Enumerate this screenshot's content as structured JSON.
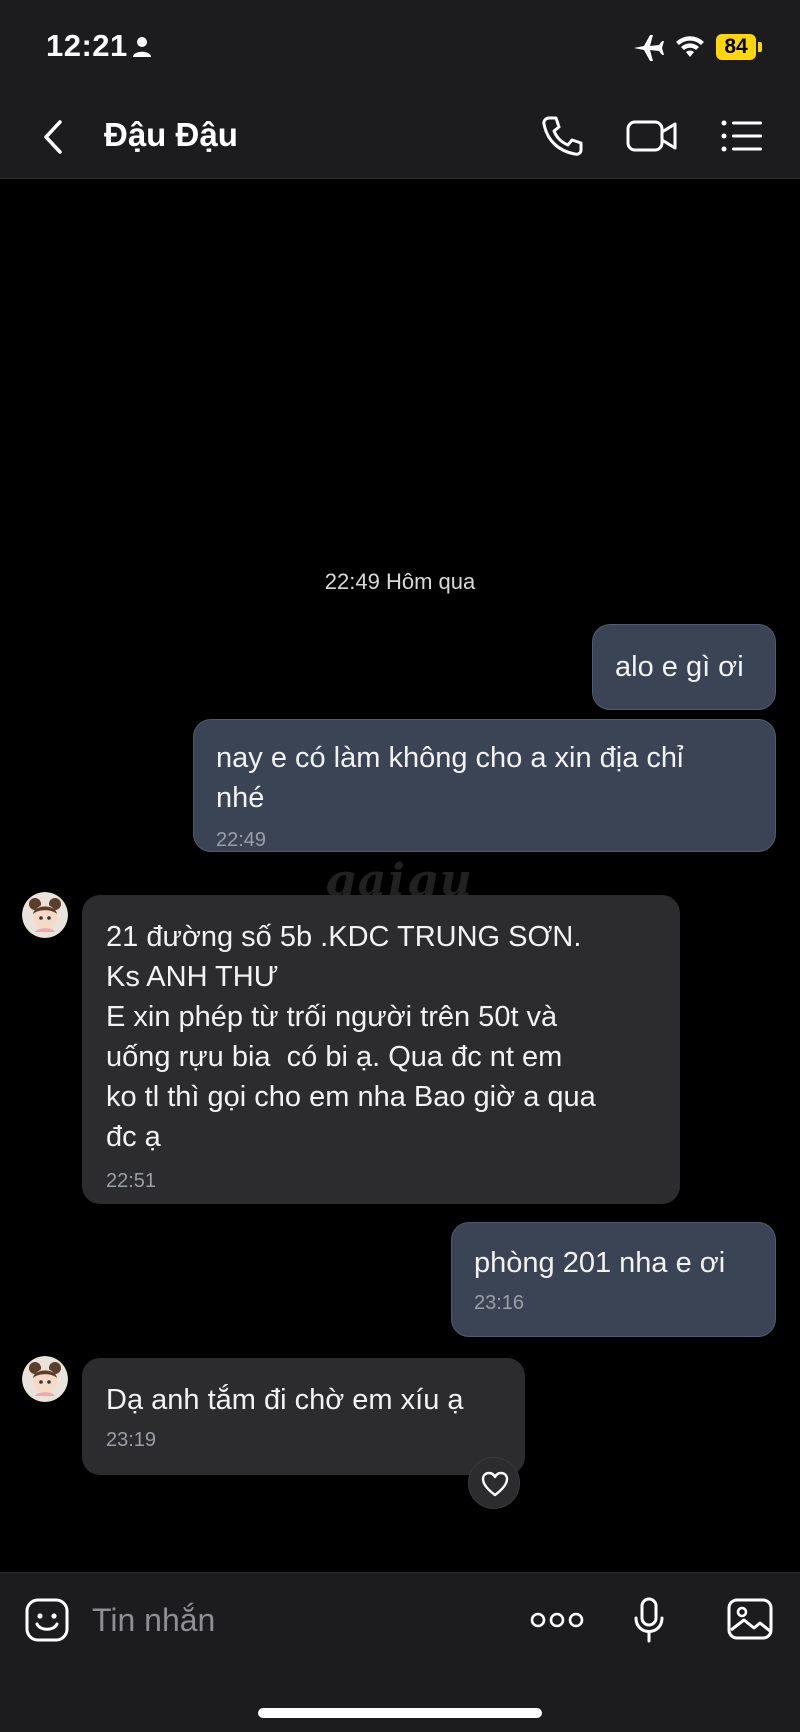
{
  "status_bar": {
    "time": "12:21",
    "battery": "84",
    "icons": [
      "person-icon",
      "airplane-icon",
      "wifi-icon",
      "battery-icon"
    ],
    "battery_color": "#ffd60a"
  },
  "header": {
    "back_icon": "chevron-left-icon",
    "title": "Đậu Đậu",
    "actions": [
      "phone-icon",
      "video-call-icon",
      "list-menu-icon"
    ]
  },
  "chat": {
    "day_separator": "22:49 Hôm qua",
    "watermark": "gaigu",
    "messages": [
      {
        "direction": "out",
        "text": "alo e gì ơi",
        "time": ""
      },
      {
        "direction": "out",
        "text": "nay e có làm không cho a xin địa chỉ\nnhé",
        "time": "22:49"
      },
      {
        "direction": "in",
        "text": "21 đường số 5b .KDC TRUNG SƠN.\nKs ANH THƯ\nE xin phép từ trối người trên 50t và\nuống rựu bia  có bi ạ. Qua đc nt em\nko tl thì gọi cho em nha Bao giờ a qua\nđc ạ",
        "time": "22:51"
      },
      {
        "direction": "out",
        "text": "phòng 201 nha e ơi",
        "time": "23:16"
      },
      {
        "direction": "in",
        "text": "Dạ anh tắm đi chờ em xíu ạ",
        "time": "23:19"
      }
    ],
    "reaction_icon": "heart-icon",
    "colors": {
      "outgoing_bubble": "#3a4455",
      "incoming_bubble": "#2c2c2e",
      "background": "#000000"
    }
  },
  "input_bar": {
    "placeholder": "Tin nhắn",
    "icons": [
      "sticker-icon",
      "more-icon",
      "microphone-icon",
      "image-icon"
    ]
  }
}
